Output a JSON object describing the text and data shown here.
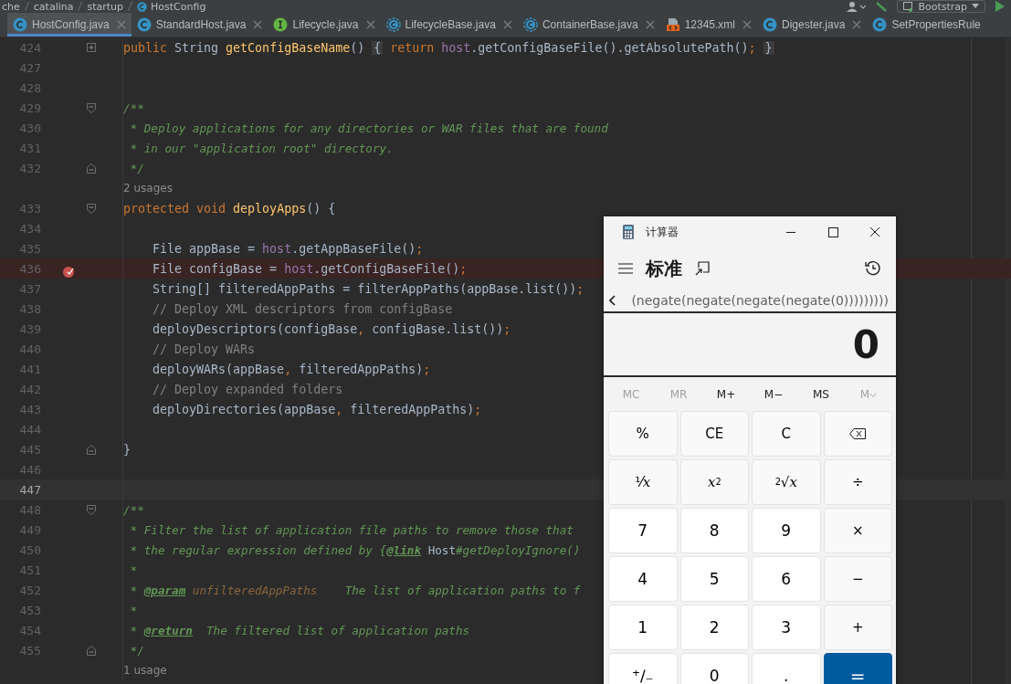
{
  "breadcrumbs": [
    {
      "label": "che"
    },
    {
      "label": "catalina"
    },
    {
      "label": "startup"
    },
    {
      "label": "HostConfig",
      "kind": "class"
    }
  ],
  "toolbar": {
    "run_config": "Bootstrap"
  },
  "tabs": [
    {
      "label": "HostConfig.java",
      "kind": "class",
      "selected": true
    },
    {
      "label": "StandardHost.java",
      "kind": "class",
      "selected": false
    },
    {
      "label": "Lifecycle.java",
      "kind": "interface",
      "selected": false
    },
    {
      "label": "LifecycleBase.java",
      "kind": "abstract",
      "selected": false
    },
    {
      "label": "ContainerBase.java",
      "kind": "abstract",
      "selected": false
    },
    {
      "label": "12345.xml",
      "kind": "xml",
      "selected": false
    },
    {
      "label": "Digester.java",
      "kind": "class",
      "selected": false
    },
    {
      "label": "SetPropertiesRule",
      "kind": "class",
      "selected": false
    }
  ],
  "editor": {
    "lines": [
      {
        "kind": "code",
        "number": "424",
        "collapsed": true,
        "tokens": [
          {
            "kind": "kw",
            "text": "public"
          },
          {
            "kind": "plain",
            "text": " String "
          },
          {
            "kind": "fn",
            "text": "getConfigBaseName"
          },
          {
            "kind": "plain",
            "text": "() "
          },
          {
            "kind": "folded",
            "text": "{"
          },
          {
            "kind": "kw",
            "text": " return "
          },
          {
            "kind": "field",
            "text": "host"
          },
          {
            "kind": "plain",
            "text": ".getConfigBaseFile().getAbsolutePath()"
          },
          {
            "kind": "punct",
            "text": "; "
          },
          {
            "kind": "folded",
            "text": "}"
          }
        ]
      },
      {
        "kind": "code",
        "number": "427"
      },
      {
        "kind": "code",
        "number": "428"
      },
      {
        "kind": "code",
        "number": "429",
        "fold_start": true,
        "tokens": [
          {
            "kind": "doc",
            "text": "/**"
          }
        ]
      },
      {
        "kind": "code",
        "number": "430",
        "tokens": [
          {
            "kind": "doc",
            "text": " * Deploy applications for any directories or WAR files that are found"
          }
        ]
      },
      {
        "kind": "code",
        "number": "431",
        "tokens": [
          {
            "kind": "doc",
            "text": " * in our \"application root\" directory."
          }
        ]
      },
      {
        "kind": "code",
        "number": "432",
        "fold_end": true,
        "tokens": [
          {
            "kind": "doc",
            "text": " */"
          }
        ]
      },
      {
        "kind": "hint",
        "text": "2 usages"
      },
      {
        "kind": "code",
        "number": "433",
        "fold_start": true,
        "tokens": [
          {
            "kind": "kw",
            "text": "protected void "
          },
          {
            "kind": "decl",
            "text": "deployApps"
          },
          {
            "kind": "plain",
            "text": "() {"
          }
        ]
      },
      {
        "kind": "code",
        "number": "434"
      },
      {
        "kind": "code",
        "number": "435",
        "tokens": [
          {
            "kind": "plain",
            "text": "    File appBase = "
          },
          {
            "kind": "field",
            "text": "host"
          },
          {
            "kind": "plain",
            "text": ".getAppBaseFile()"
          },
          {
            "kind": "punct",
            "text": ";"
          }
        ]
      },
      {
        "kind": "code",
        "number": "436",
        "breakpoint": true,
        "tokens": [
          {
            "kind": "plain",
            "text": "    File configBase = "
          },
          {
            "kind": "field",
            "text": "host"
          },
          {
            "kind": "plain",
            "text": ".getConfigBaseFile()"
          },
          {
            "kind": "punct",
            "text": ";"
          }
        ]
      },
      {
        "kind": "code",
        "number": "437",
        "tokens": [
          {
            "kind": "plain",
            "text": "    String[] filteredAppPaths = filterAppPaths(appBase.list())"
          },
          {
            "kind": "punct",
            "text": ";"
          }
        ]
      },
      {
        "kind": "code",
        "number": "438",
        "tokens": [
          {
            "kind": "com",
            "text": "    // Deploy XML descriptors from configBase"
          }
        ]
      },
      {
        "kind": "code",
        "number": "439",
        "tokens": [
          {
            "kind": "plain",
            "text": "    deployDescriptors(configBase"
          },
          {
            "kind": "punct",
            "text": ", "
          },
          {
            "kind": "plain",
            "text": "configBase.list())"
          },
          {
            "kind": "punct",
            "text": ";"
          }
        ]
      },
      {
        "kind": "code",
        "number": "440",
        "tokens": [
          {
            "kind": "com",
            "text": "    // Deploy WARs"
          }
        ]
      },
      {
        "kind": "code",
        "number": "441",
        "tokens": [
          {
            "kind": "plain",
            "text": "    deployWARs(appBase"
          },
          {
            "kind": "punct",
            "text": ", "
          },
          {
            "kind": "plain",
            "text": "filteredAppPaths)"
          },
          {
            "kind": "punct",
            "text": ";"
          }
        ]
      },
      {
        "kind": "code",
        "number": "442",
        "tokens": [
          {
            "kind": "com",
            "text": "    // Deploy expanded folders"
          }
        ]
      },
      {
        "kind": "code",
        "number": "443",
        "tokens": [
          {
            "kind": "plain",
            "text": "    deployDirectories(appBase"
          },
          {
            "kind": "punct",
            "text": ", "
          },
          {
            "kind": "plain",
            "text": "filteredAppPaths)"
          },
          {
            "kind": "punct",
            "text": ";"
          }
        ]
      },
      {
        "kind": "code",
        "number": "444"
      },
      {
        "kind": "code",
        "number": "445",
        "fold_end": true,
        "tokens": [
          {
            "kind": "plain",
            "text": "}"
          }
        ]
      },
      {
        "kind": "code",
        "number": "446"
      },
      {
        "kind": "code",
        "number": "447",
        "current": true
      },
      {
        "kind": "code",
        "number": "448",
        "fold_start": true,
        "tokens": [
          {
            "kind": "doc",
            "text": "/**"
          }
        ]
      },
      {
        "kind": "code",
        "number": "449",
        "tokens": [
          {
            "kind": "doc",
            "text": " * Filter the list of application file paths to remove those that"
          }
        ]
      },
      {
        "kind": "code",
        "number": "450",
        "tokens": [
          {
            "kind": "doc",
            "text": " * the regular expression defined by {"
          },
          {
            "kind": "tag",
            "text": "@link"
          },
          {
            "kind": "ref",
            "text": " Host"
          },
          {
            "kind": "doc",
            "text": "#getDeployIgnore()"
          }
        ]
      },
      {
        "kind": "code",
        "number": "451",
        "tokens": [
          {
            "kind": "doc",
            "text": " *"
          }
        ]
      },
      {
        "kind": "code",
        "number": "452",
        "tokens": [
          {
            "kind": "doc",
            "text": " * "
          },
          {
            "kind": "tag",
            "text": "@param"
          },
          {
            "kind": "param",
            "text": " unfilteredAppPaths"
          },
          {
            "kind": "doc",
            "text": "    The list of application paths to f"
          }
        ]
      },
      {
        "kind": "code",
        "number": "453",
        "tokens": [
          {
            "kind": "doc",
            "text": " *"
          }
        ]
      },
      {
        "kind": "code",
        "number": "454",
        "tokens": [
          {
            "kind": "doc",
            "text": " * "
          },
          {
            "kind": "tag",
            "text": "@return"
          },
          {
            "kind": "doc",
            "text": "  The filtered list of application paths"
          }
        ]
      },
      {
        "kind": "code",
        "number": "455",
        "fold_end": true,
        "tokens": [
          {
            "kind": "doc",
            "text": " */"
          }
        ]
      },
      {
        "kind": "hint",
        "text": "1 usage"
      }
    ]
  },
  "calculator": {
    "title": "计算器",
    "mode": "标准",
    "expression": "(negate(negate(negate(negate(0)))))))))",
    "display": "0",
    "memory": [
      {
        "label": "MC",
        "disabled": true
      },
      {
        "label": "MR",
        "disabled": true
      },
      {
        "label": "M+",
        "disabled": false
      },
      {
        "label": "M−",
        "disabled": false
      },
      {
        "label": "MS",
        "disabled": false
      },
      {
        "label": "M",
        "disabled": true
      }
    ],
    "keys": [
      {
        "kind": "op",
        "label": "%"
      },
      {
        "kind": "op",
        "label": "CE"
      },
      {
        "kind": "op",
        "label": "C"
      },
      {
        "kind": "backspace"
      },
      {
        "kind": "op",
        "label": "¹⁄*x*"
      },
      {
        "kind": "op",
        "label": "*x*$^{2}$"
      },
      {
        "kind": "op",
        "label": "$^{2}$√*x*"
      },
      {
        "kind": "op",
        "label": "÷"
      },
      {
        "kind": "digit",
        "label": "7"
      },
      {
        "kind": "digit",
        "label": "8"
      },
      {
        "kind": "digit",
        "label": "9"
      },
      {
        "kind": "op",
        "label": "×"
      },
      {
        "kind": "digit",
        "label": "4"
      },
      {
        "kind": "digit",
        "label": "5"
      },
      {
        "kind": "digit",
        "label": "6"
      },
      {
        "kind": "op",
        "label": "−"
      },
      {
        "kind": "digit",
        "label": "1"
      },
      {
        "kind": "digit",
        "label": "2"
      },
      {
        "kind": "digit",
        "label": "3"
      },
      {
        "kind": "op",
        "label": "+"
      },
      {
        "kind": "digit",
        "label": "⁺∕₋"
      },
      {
        "kind": "digit",
        "label": "0"
      },
      {
        "kind": "digit",
        "label": "."
      },
      {
        "kind": "equals",
        "label": "="
      }
    ]
  }
}
